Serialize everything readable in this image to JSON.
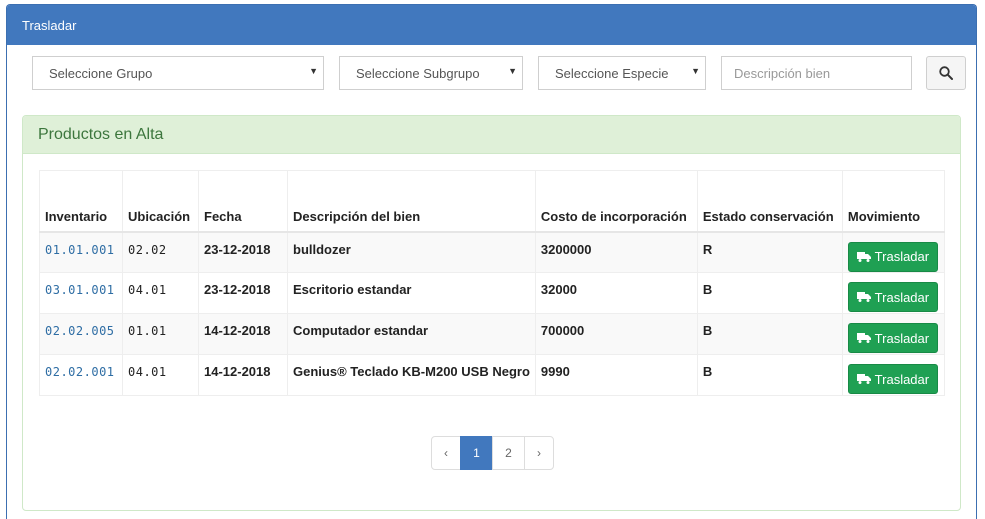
{
  "panel": {
    "title": "Trasladar"
  },
  "filters": {
    "grupo": "Seleccione Grupo",
    "subgrupo": "Seleccione Subgrupo",
    "especie": "Seleccione Especie",
    "descripcion_placeholder": "Descripción bien"
  },
  "products_panel": {
    "title": "Productos en Alta"
  },
  "table": {
    "headers": [
      "Inventario",
      "Ubicación",
      "Fecha",
      "Descripción del bien",
      "Costo de incorporación",
      "Estado conservación",
      "Movimiento"
    ],
    "rows": [
      {
        "inventario": "01.01.001",
        "ubicacion": "02.02",
        "fecha": "23-12-2018",
        "descripcion": "bulldozer",
        "costo": "3200000",
        "estado": "R",
        "accion": "Trasladar"
      },
      {
        "inventario": "03.01.001",
        "ubicacion": "04.01",
        "fecha": "23-12-2018",
        "descripcion": "Escritorio estandar",
        "costo": "32000",
        "estado": "B",
        "accion": "Trasladar"
      },
      {
        "inventario": "02.02.005",
        "ubicacion": "01.01",
        "fecha": "14-12-2018",
        "descripcion": "Computador estandar",
        "costo": "700000",
        "estado": "B",
        "accion": "Trasladar"
      },
      {
        "inventario": "02.02.001",
        "ubicacion": "04.01",
        "fecha": "14-12-2018",
        "descripcion": "Genius® Teclado KB-M200 USB Negro",
        "costo": "9990",
        "estado": "B",
        "accion": "Trasladar"
      }
    ]
  },
  "pagination": {
    "prev": "‹",
    "pages": [
      "1",
      "2"
    ],
    "next": "›",
    "active_page": "1"
  }
}
